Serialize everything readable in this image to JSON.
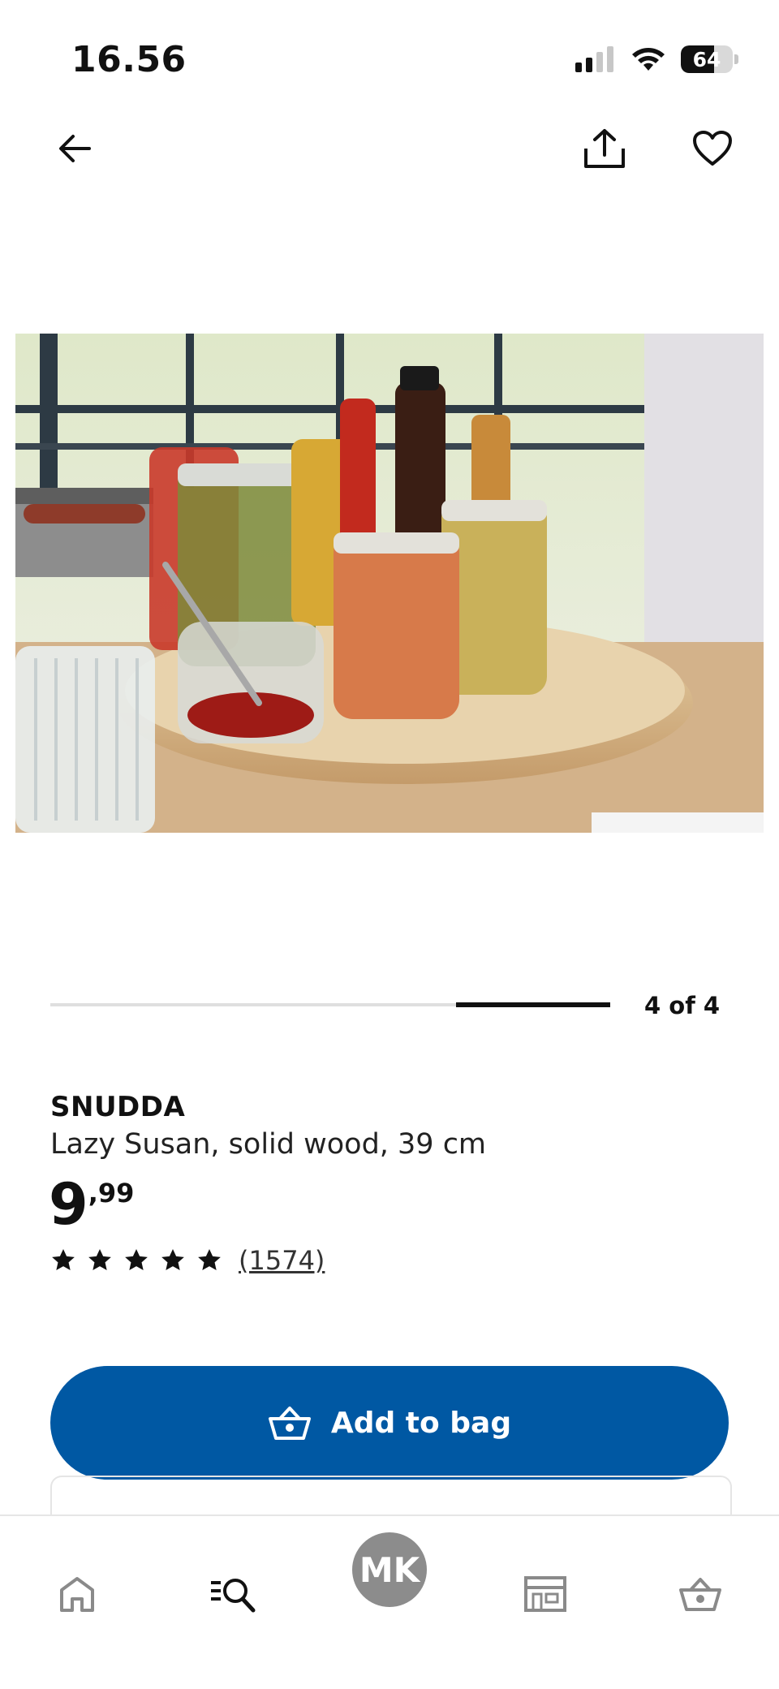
{
  "status_bar": {
    "time": "16.56",
    "battery": "64",
    "battery_level": 0.64
  },
  "header": {
    "back_icon": "arrow-left-icon",
    "share_icon": "share-icon",
    "favorite_icon": "heart-icon"
  },
  "gallery": {
    "counter": "4 of 4",
    "current": 4,
    "total": 4,
    "image_icon": "product-photo"
  },
  "product": {
    "name": "SNUDDA",
    "description": "Lazy Susan, solid wood, 39 cm",
    "price_int": "9",
    "price_dec": ",99",
    "rating": 5,
    "review_count": "(1574)"
  },
  "cta": {
    "label": "Add to bag",
    "icon": "basket-icon",
    "color": "#0058a3"
  },
  "bottom_nav": {
    "items": [
      {
        "name": "home",
        "icon": "home-icon"
      },
      {
        "name": "search",
        "icon": "search-icon"
      },
      {
        "name": "profile",
        "initials": "MK"
      },
      {
        "name": "stores",
        "icon": "store-icon"
      },
      {
        "name": "bag",
        "icon": "basket-icon"
      }
    ]
  }
}
